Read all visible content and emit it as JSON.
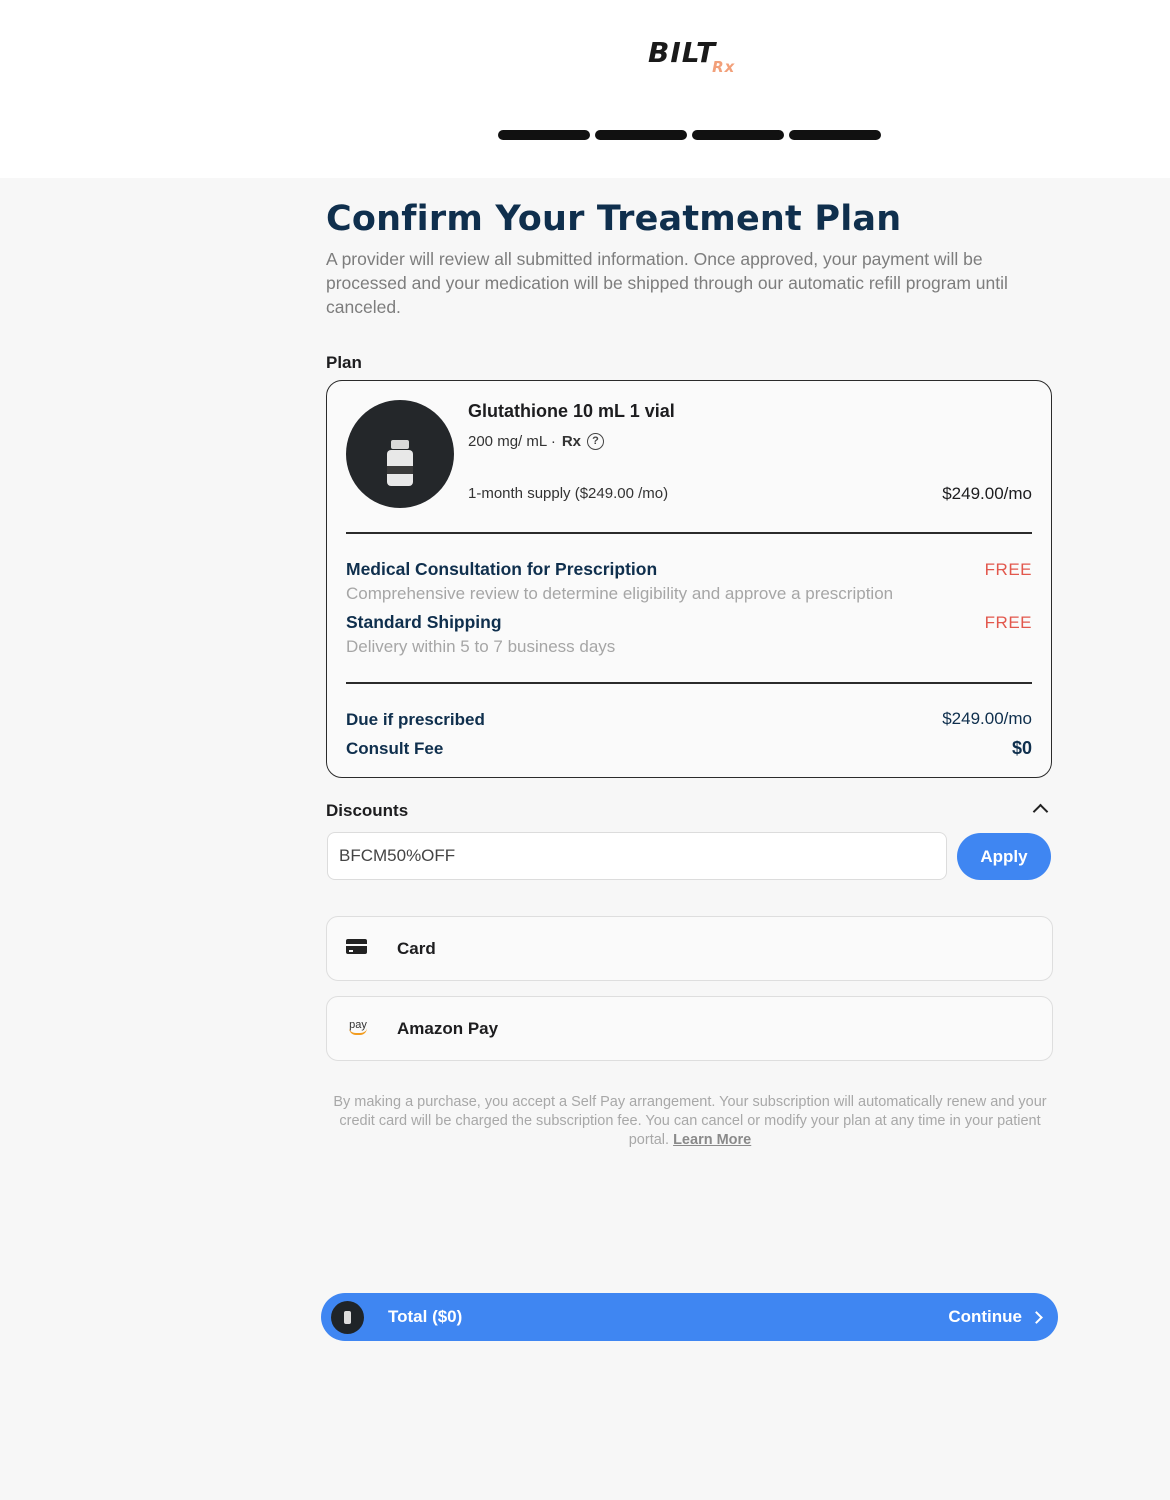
{
  "brand": {
    "logo_text": "BILT",
    "logo_suffix": "Rx"
  },
  "progress": {
    "steps_total": 4,
    "steps_complete": 4
  },
  "header": {
    "title": "Confirm Your Treatment Plan",
    "subtitle": "A provider will review all submitted information. Once approved, your payment will be processed and your medication will be shipped through our automatic refill program until canceled."
  },
  "plan": {
    "section_label": "Plan",
    "product_name": "Glutathione 10 mL 1 vial",
    "dose": "200 mg/ mL ·",
    "rx_label": "Rx",
    "help_icon": "?",
    "supply": "1-month supply ($249.00 /mo)",
    "price": "$249.00/mo",
    "items": [
      {
        "title": "Medical Consultation for Prescription",
        "description": "Comprehensive review to determine eligibility and approve a prescription",
        "badge": "FREE"
      },
      {
        "title": "Standard Shipping",
        "description": "Delivery within 5 to 7 business days",
        "badge": "FREE"
      }
    ],
    "due_label": "Due if prescribed",
    "due_value": "$249.00/mo",
    "consult_label": "Consult Fee",
    "consult_value": "$0"
  },
  "discounts": {
    "section_label": "Discounts",
    "code_value": "BFCM50%OFF",
    "apply_label": "Apply"
  },
  "payment_methods": [
    {
      "label": "Card",
      "icon": "credit-card-icon"
    },
    {
      "label": "Amazon Pay",
      "icon": "amazon-pay-icon",
      "icon_text": "pay"
    }
  ],
  "disclaimer": {
    "text": "By making a purchase, you accept a Self Pay arrangement. Your subscription will automatically renew and your credit card will be charged the subscription fee. You can cancel or modify your plan at any time in your patient portal.",
    "link_label": "Learn More"
  },
  "footer": {
    "total_label": "Total ($0)",
    "continue_label": "Continue"
  },
  "colors": {
    "accent": "#3f86f2",
    "heading": "#0f2f4d",
    "free": "#e2574c"
  }
}
